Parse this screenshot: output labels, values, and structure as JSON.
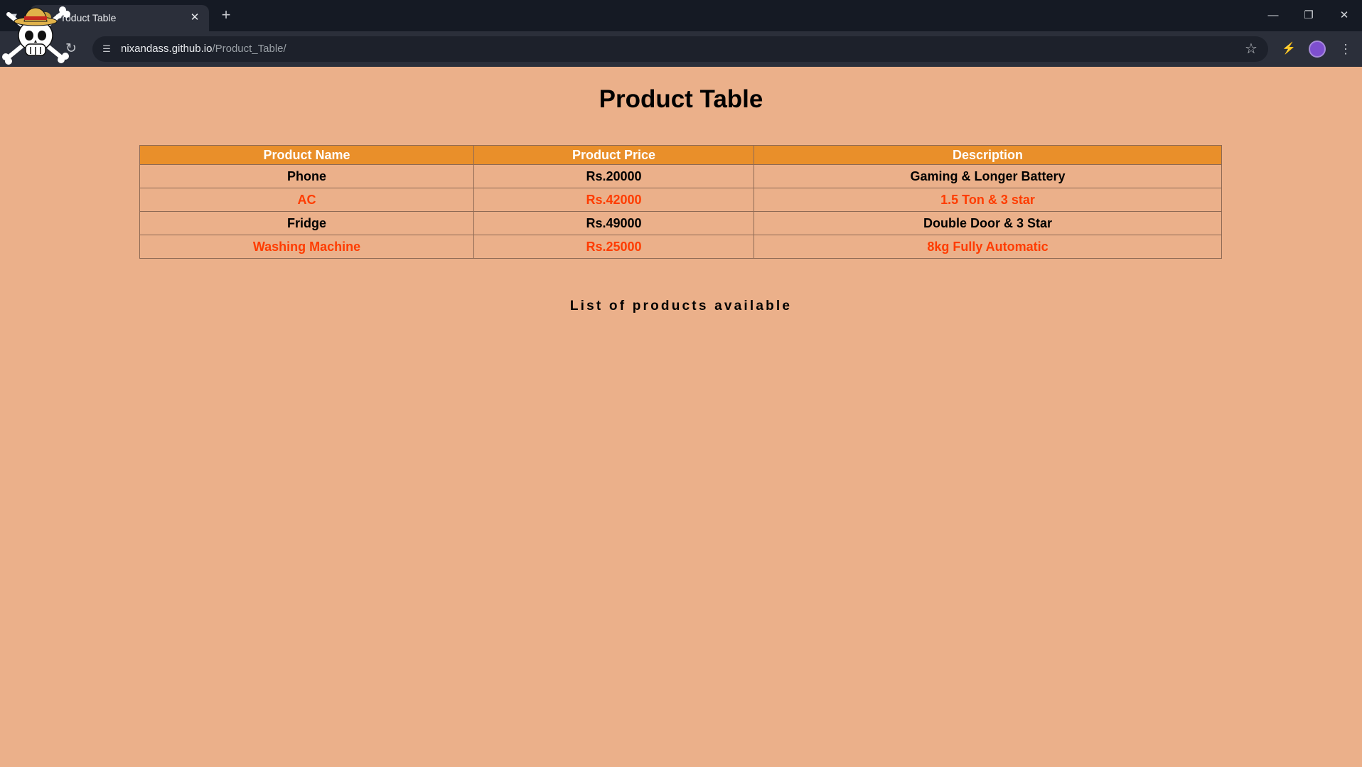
{
  "browser": {
    "tab_title": "Product Table",
    "url_host": "nixandass.github.io",
    "url_path": "/Product_Table/"
  },
  "page": {
    "heading": "Product Table",
    "table": {
      "headers": [
        "Product Name",
        "Product Price",
        "Description"
      ],
      "rows": [
        {
          "name": "Phone",
          "price": "Rs.20000",
          "description": "Gaming & Longer Battery"
        },
        {
          "name": "AC",
          "price": "Rs.42000",
          "description": "1.5 Ton & 3 star"
        },
        {
          "name": "Fridge",
          "price": "Rs.49000",
          "description": "Double Door & 3 Star"
        },
        {
          "name": "Washing Machine",
          "price": "Rs.25000",
          "description": "8kg Fully Automatic"
        }
      ]
    },
    "caption": "List of products available"
  },
  "colors": {
    "page_background": "#ebb08a",
    "header_background": "#e98f2a",
    "accent_text": "#ff3c00"
  }
}
